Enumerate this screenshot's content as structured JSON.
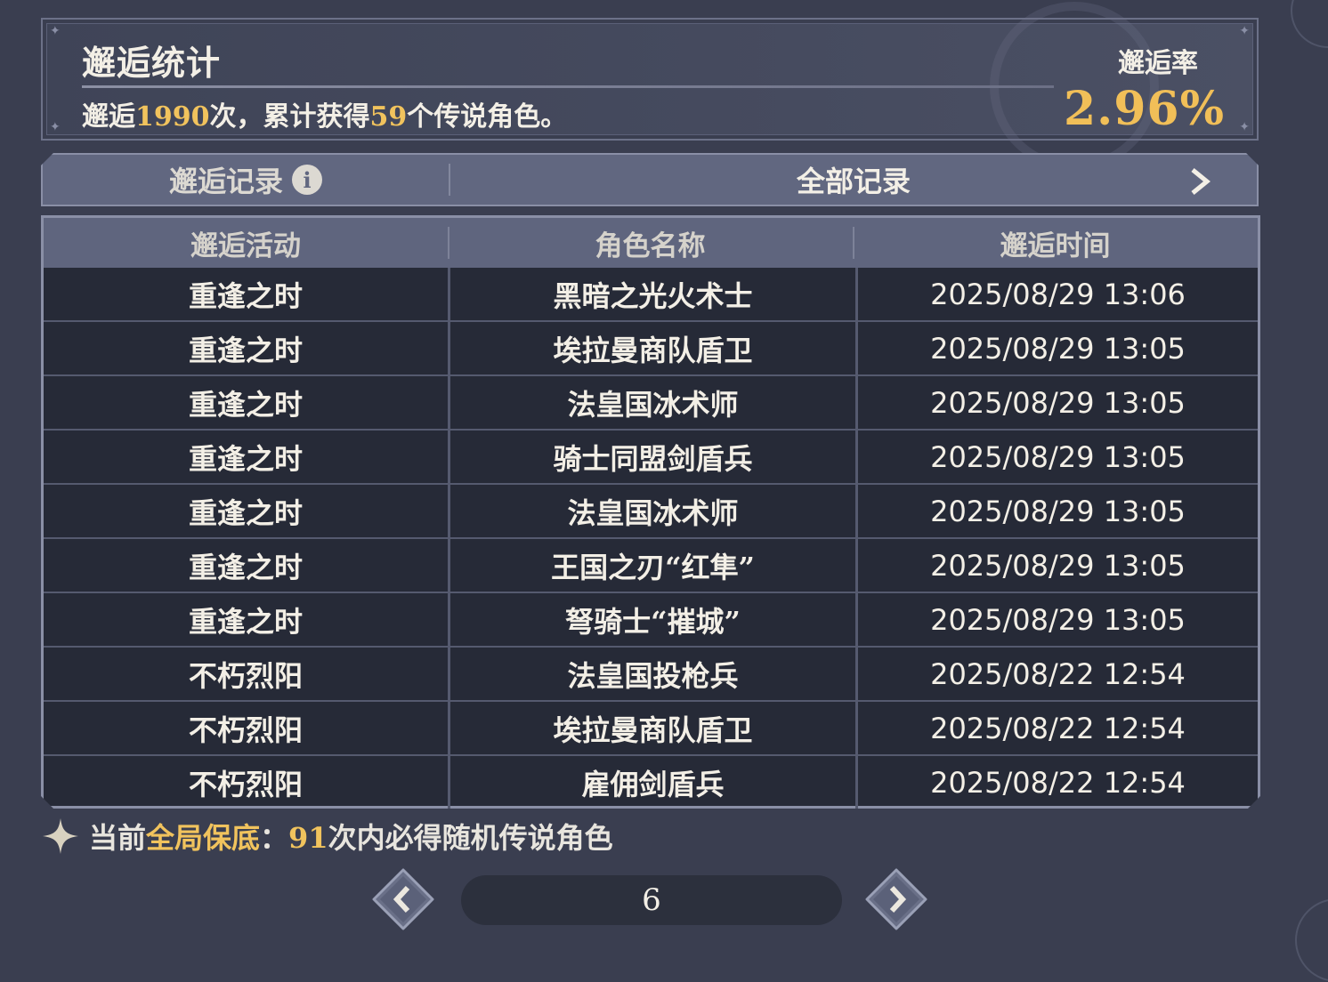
{
  "stats": {
    "title": "邂逅统计",
    "summary_prefix": "邂逅",
    "encounter_count": "1990",
    "summary_mid": "次，累计获得",
    "legend_count": "59",
    "summary_suffix": "个传说角色。",
    "rate_label": "邂逅率",
    "rate_value": "2.96%"
  },
  "tabs": {
    "left_label": "邂逅记录",
    "right_label": "全部记录"
  },
  "table": {
    "headers": [
      "邂逅活动",
      "角色名称",
      "邂逅时间"
    ],
    "rows": [
      {
        "event": "重逢之时",
        "character": "黑暗之光火术士",
        "time": "2025/08/29 13:06"
      },
      {
        "event": "重逢之时",
        "character": "埃拉曼商队盾卫",
        "time": "2025/08/29 13:05"
      },
      {
        "event": "重逢之时",
        "character": "法皇国冰术师",
        "time": "2025/08/29 13:05"
      },
      {
        "event": "重逢之时",
        "character": "骑士同盟剑盾兵",
        "time": "2025/08/29 13:05"
      },
      {
        "event": "重逢之时",
        "character": "法皇国冰术师",
        "time": "2025/08/29 13:05"
      },
      {
        "event": "重逢之时",
        "character": "王国之刃“红隼”",
        "time": "2025/08/29 13:05"
      },
      {
        "event": "重逢之时",
        "character": "弩骑士“摧城”",
        "time": "2025/08/29 13:05"
      },
      {
        "event": "不朽烈阳",
        "character": "法皇国投枪兵",
        "time": "2025/08/22 12:54"
      },
      {
        "event": "不朽烈阳",
        "character": "埃拉曼商队盾卫",
        "time": "2025/08/22 12:54"
      },
      {
        "event": "不朽烈阳",
        "character": "雇佣剑盾兵",
        "time": "2025/08/22 12:54"
      }
    ]
  },
  "pity": {
    "prefix": "当前",
    "highlight": "全局保底",
    "colon": "：",
    "count": "91",
    "suffix": "次内必得随机传说角色"
  },
  "pager": {
    "page": "6"
  },
  "icons": {
    "info": "info-icon",
    "next_tab": "chevron-right-icon",
    "pity": "sparkle-star-icon",
    "prev_page": "chevron-left-icon",
    "next_page": "chevron-right-icon"
  },
  "colors": {
    "background": "#3a3e50",
    "accent_gold": "#f1c35d",
    "header_bar": "#5f657e",
    "table_body": "#262a37"
  }
}
